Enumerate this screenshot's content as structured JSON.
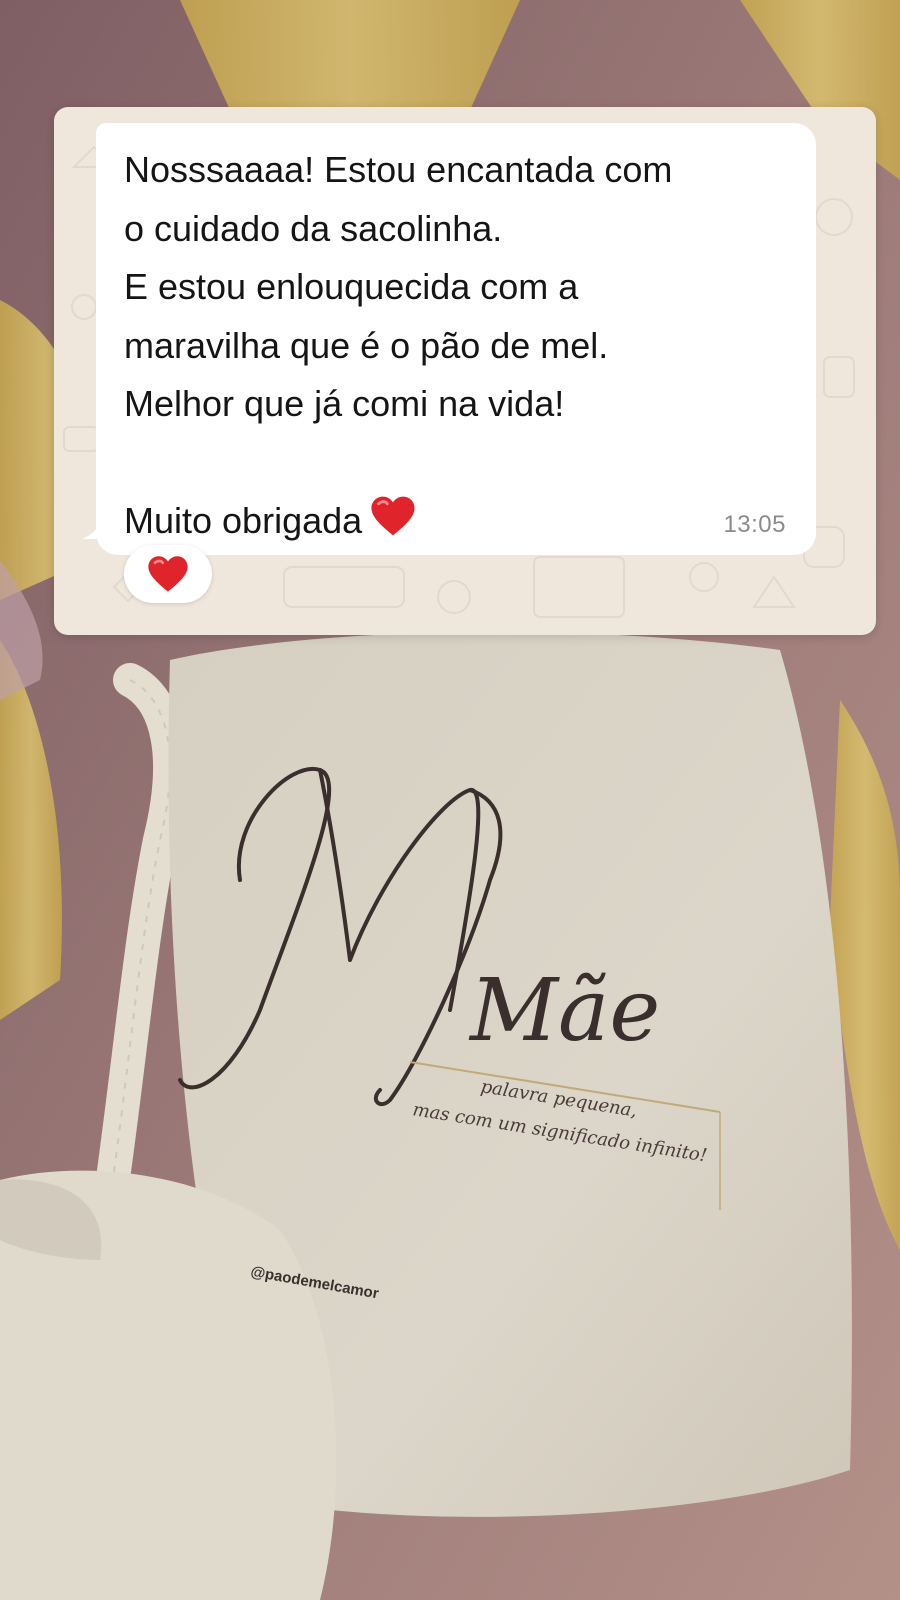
{
  "message": {
    "lines": [
      "Nosssaaaa! Estou encantada com",
      "o cuidado da sacolinha.",
      "E estou enlouquecida com a",
      "maravilha que é o pão de mel.",
      "Melhor que já comi na vida!",
      "",
      "Muito obrigada"
    ],
    "trailing_emoji": "heart-emoji",
    "time": "13:05"
  },
  "reaction": {
    "emoji": "heart-emoji"
  },
  "bag_print": {
    "headline": "Mãe",
    "tagline_line1": "palavra pequena,",
    "tagline_line2": "mas com um significado infinito!",
    "handle": "@paodemelcamor"
  },
  "colors": {
    "background_pink": "#8e6a6c",
    "ribbon_yellow": "#d9c06a",
    "bag_canvas": "#ddd8cc",
    "bubble_white": "#ffffff",
    "chat_wallpaper": "#efe7dc",
    "heart_red": "#e0242b",
    "time_gray": "#8b8b8b"
  }
}
